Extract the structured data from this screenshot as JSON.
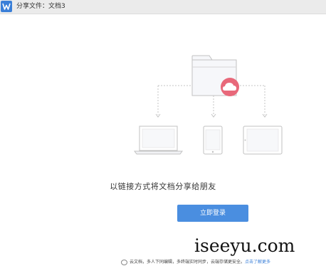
{
  "window": {
    "title": "分享文件：文档3"
  },
  "main": {
    "message": "以链接方式将文档分享给朋友",
    "login_button": "立即登录"
  },
  "footer": {
    "info": "云文档，多人下同编辑，多终端实时同步，云端存储更安全。",
    "link": "点击了解更多"
  },
  "watermark": "iseeyu.com",
  "colors": {
    "accent": "#4a8ee0",
    "cloud_badge": "#e8687a",
    "titlebar": "#ebebeb"
  }
}
